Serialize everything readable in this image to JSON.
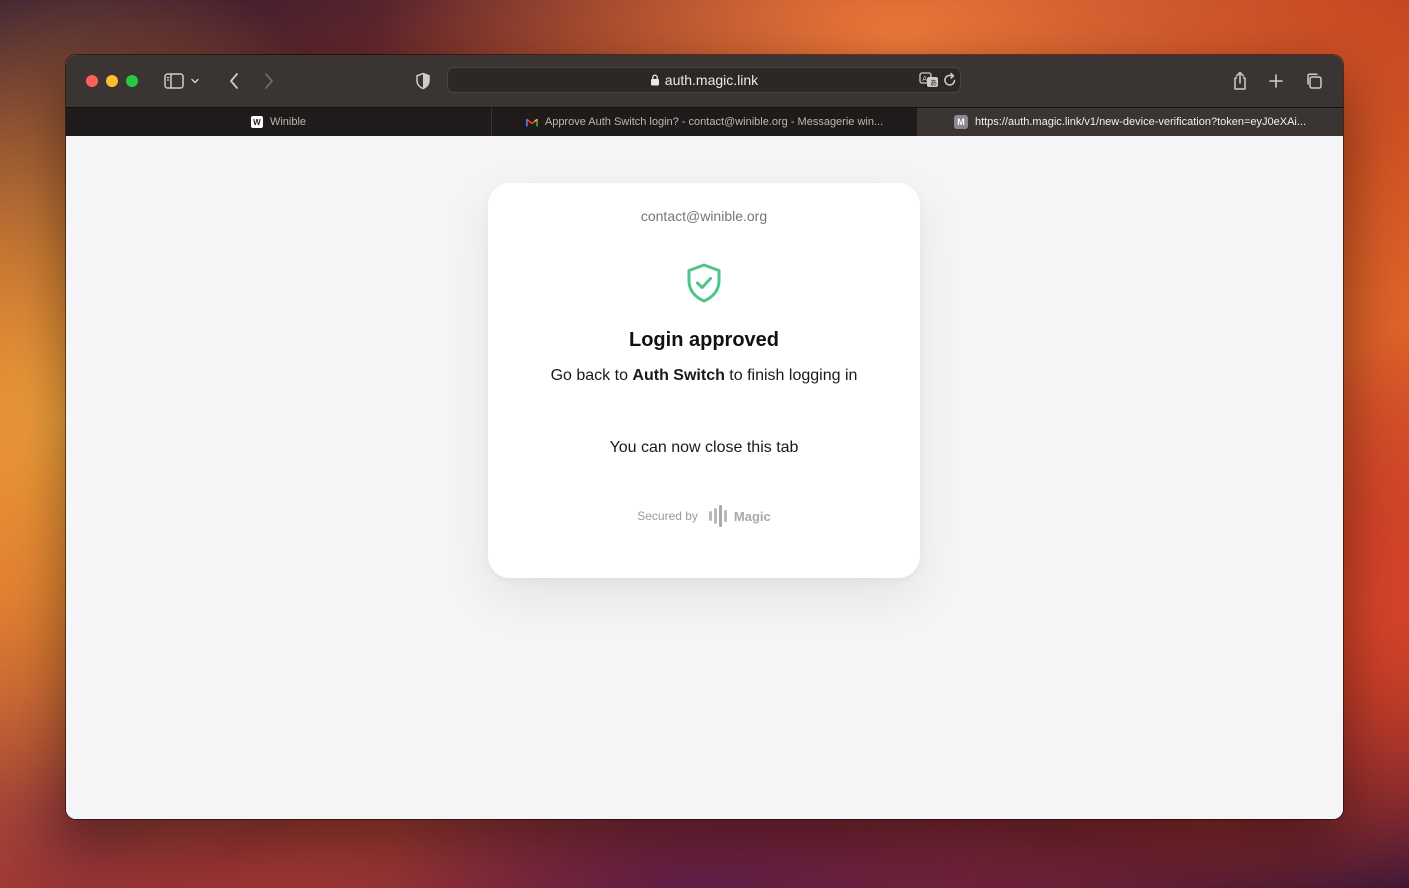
{
  "browser": {
    "address_url": "auth.magic.link",
    "tabs": [
      {
        "label": "Winible",
        "favicon": "W"
      },
      {
        "label": "Approve Auth Switch login? - contact@winible.org - Messagerie win...",
        "favicon": "gmail-icon"
      },
      {
        "label": "https://auth.magic.link/v1/new-device-verification?token=eyJ0eXAi...",
        "favicon": "M"
      }
    ]
  },
  "card": {
    "email": "contact@winible.org",
    "title": "Login approved",
    "message_prefix": "Go back to ",
    "message_app": "Auth Switch",
    "message_suffix": " to finish logging in",
    "close_message": "You can now close this tab",
    "secured_by": "Secured by",
    "brand": "Magic"
  },
  "colors": {
    "shield_accent": "#4cc58a",
    "toolbar": "#3a3533",
    "page_bg": "#f5f5f7"
  }
}
